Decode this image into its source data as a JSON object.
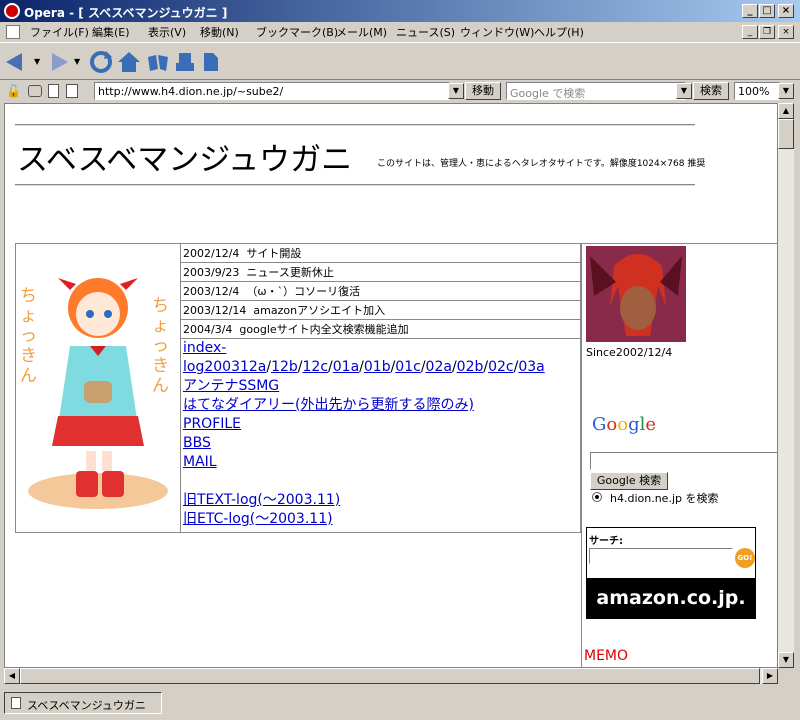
{
  "window": {
    "title": "Opera - [ スベスベマンジュウガニ ]"
  },
  "menu": [
    "ファイル(F)",
    "編集(E)",
    "表示(V)",
    "移動(N)",
    "ブックマーク(B)",
    "メール(M)",
    "ニュース(S)",
    "ウィンドウ(W)",
    "ヘルプ(H)"
  ],
  "address": {
    "url": "http://www.h4.dion.ne.jp/~sube2/",
    "go_label": "移動",
    "search_placeholder": "Google で検索",
    "search_label": "検索",
    "zoom": "100%"
  },
  "site": {
    "title": "スベスベマンジュウガニ",
    "subtitle": "このサイトは、管理人・恵によるヘタレオタサイトです。解像度1024×768 推奨",
    "news": [
      {
        "date": "2002/12/4",
        "text": "サイト開設"
      },
      {
        "date": "2003/9/23",
        "text": "ニュース更新休止"
      },
      {
        "date": "2003/12/4",
        "text": "（ω・`）コソーリ復活"
      },
      {
        "date": "2003/12/14",
        "text": "amazonアソシエイト加入"
      },
      {
        "date": "2004/3/4",
        "text": "googleサイト内全文検索機能追加"
      }
    ],
    "log_label": "index-log200312a",
    "logs": [
      "12b",
      "12c",
      "01a",
      "01b",
      "01c",
      "02a",
      "02b",
      "02c",
      "03a"
    ],
    "links": [
      "アンテナSSMG",
      "はてなダイアリー(外出先から更新する際のみ)",
      "PROFILE",
      "BBS",
      "MAIL"
    ],
    "old_links": [
      "旧TEXT-log(～2003.11)",
      "旧ETC-log(～2003.11)"
    ],
    "since": "Since2002/12/4",
    "google_search_btn": "Google 検索",
    "site_search_option": "h4.dion.ne.jp を検索",
    "amazon_search_label": "サーチ:",
    "amazon_logo": "amazon.co.jp.",
    "go_btn": "GO!",
    "memo": "MEMO",
    "left_art_text": "ちょっきん",
    "right_art_text": "ちょっきん"
  },
  "status": {
    "tab_title": "スベスベマンジュウガニ"
  }
}
